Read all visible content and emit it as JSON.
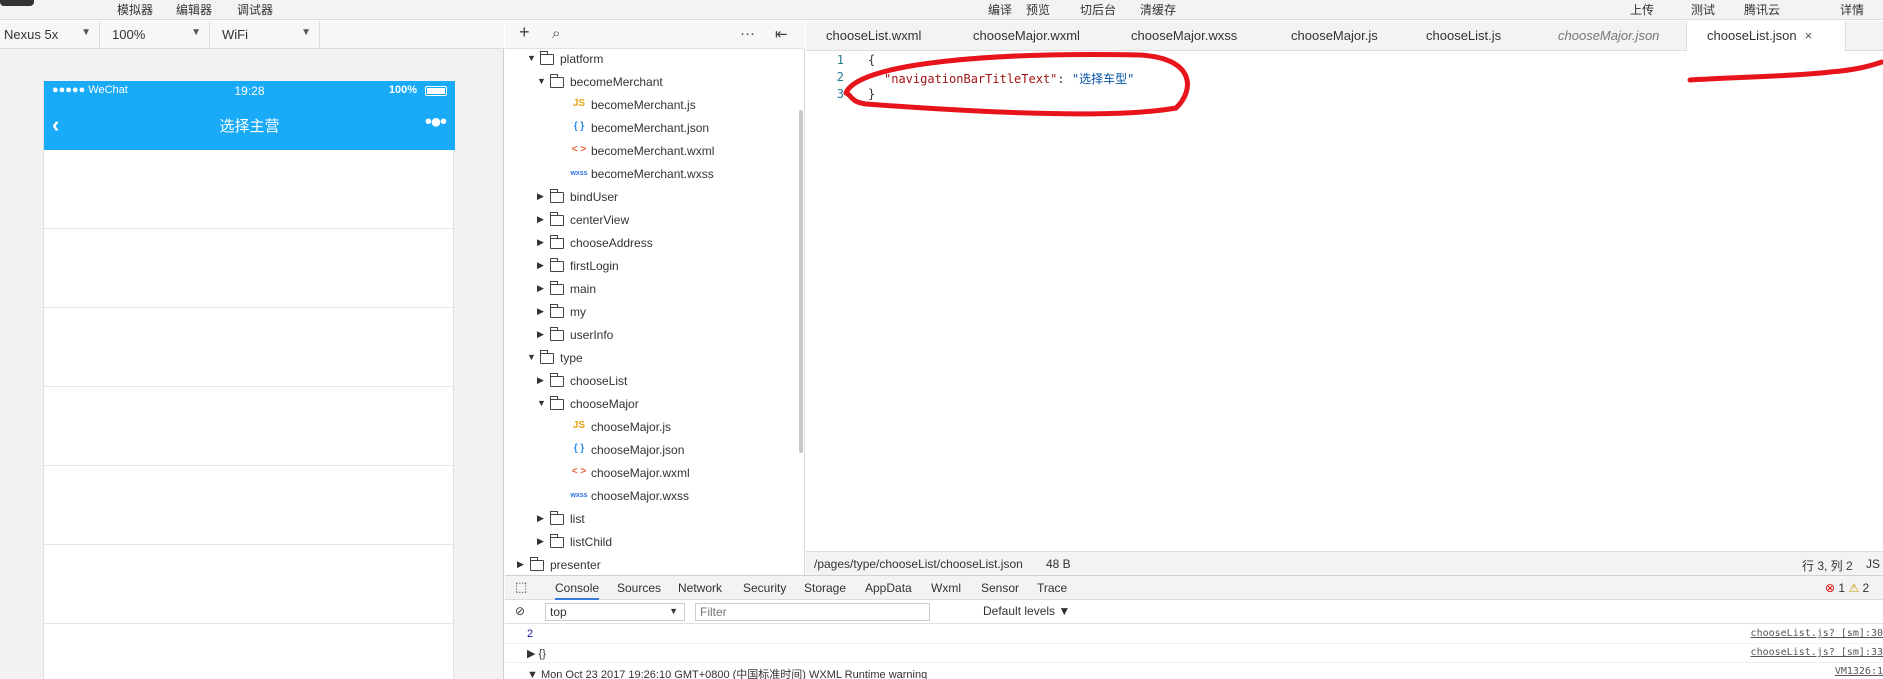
{
  "toolbar": {
    "left_items": [
      "模拟器",
      "编辑器",
      "调试器"
    ],
    "center_items": [
      "编译",
      "预览",
      "切后台",
      "清缓存"
    ],
    "right_items": [
      "上传",
      "测试",
      "腾讯云",
      "详情"
    ]
  },
  "simulator_controls": {
    "device": "Nexus 5x",
    "zoom": "100%",
    "network": "WiFi"
  },
  "phone": {
    "carrier": "●●●●● WeChat",
    "time": "19:28",
    "battery": "100%",
    "nav_title": "选择主营",
    "back_icon": "chevron-left-icon",
    "more_icon": "more-dots-icon",
    "row_count_visible": 7
  },
  "filetree": {
    "items": [
      {
        "type": "folder",
        "name": "platform",
        "expanded": true,
        "depth": 0
      },
      {
        "type": "folder",
        "name": "becomeMerchant",
        "expanded": true,
        "depth": 1
      },
      {
        "type": "file",
        "kind": "js",
        "icon": "JS",
        "name": "becomeMerchant.js",
        "depth": 2
      },
      {
        "type": "file",
        "kind": "json",
        "icon": "{ }",
        "name": "becomeMerchant.json",
        "depth": 2
      },
      {
        "type": "file",
        "kind": "wxml",
        "icon": "< >",
        "name": "becomeMerchant.wxml",
        "depth": 2
      },
      {
        "type": "file",
        "kind": "wxss",
        "icon": "wxss",
        "name": "becomeMerchant.wxss",
        "depth": 2
      },
      {
        "type": "folder",
        "name": "bindUser",
        "expanded": false,
        "depth": 1
      },
      {
        "type": "folder",
        "name": "centerView",
        "expanded": false,
        "depth": 1
      },
      {
        "type": "folder",
        "name": "chooseAddress",
        "expanded": false,
        "depth": 1
      },
      {
        "type": "folder",
        "name": "firstLogin",
        "expanded": false,
        "depth": 1
      },
      {
        "type": "folder",
        "name": "main",
        "expanded": false,
        "depth": 1
      },
      {
        "type": "folder",
        "name": "my",
        "expanded": false,
        "depth": 1
      },
      {
        "type": "folder",
        "name": "userInfo",
        "expanded": false,
        "depth": 1
      },
      {
        "type": "folder",
        "name": "type",
        "expanded": true,
        "depth": 0
      },
      {
        "type": "folder",
        "name": "chooseList",
        "expanded": false,
        "depth": 1
      },
      {
        "type": "folder",
        "name": "chooseMajor",
        "expanded": true,
        "depth": 1
      },
      {
        "type": "file",
        "kind": "js",
        "icon": "JS",
        "name": "chooseMajor.js",
        "depth": 2
      },
      {
        "type": "file",
        "kind": "json",
        "icon": "{ }",
        "name": "chooseMajor.json",
        "depth": 2
      },
      {
        "type": "file",
        "kind": "wxml",
        "icon": "< >",
        "name": "chooseMajor.wxml",
        "depth": 2
      },
      {
        "type": "file",
        "kind": "wxss",
        "icon": "wxss",
        "name": "chooseMajor.wxss",
        "depth": 2
      },
      {
        "type": "folder",
        "name": "list",
        "expanded": false,
        "depth": 1
      },
      {
        "type": "folder",
        "name": "listChild",
        "expanded": false,
        "depth": 1
      },
      {
        "type": "folder",
        "name": "presenter",
        "expanded": false,
        "depth": -1
      }
    ]
  },
  "tabs": [
    {
      "label": "chooseList.wxml",
      "style": "normal"
    },
    {
      "label": "chooseMajor.wxml",
      "style": "normal"
    },
    {
      "label": "chooseMajor.wxss",
      "style": "normal"
    },
    {
      "label": "chooseMajor.js",
      "style": "normal"
    },
    {
      "label": "chooseList.js",
      "style": "normal"
    },
    {
      "label": "chooseMajor.json",
      "style": "italic"
    },
    {
      "label": "chooseList.json",
      "style": "active",
      "close": "×"
    }
  ],
  "editor": {
    "line_numbers": [
      "1",
      "2",
      "3"
    ],
    "line1": "{",
    "line2_key": "\"navigationBarTitleText\"",
    "line2_sep": ": ",
    "line2_value": "\"选择车型\"",
    "line3": "}"
  },
  "statusline": {
    "path": "/pages/type/chooseList/chooseList.json",
    "size": "48 B",
    "cursor": "行 3, 列 2",
    "lang": "JS"
  },
  "console": {
    "tabs": [
      "Console",
      "Sources",
      "Network",
      "Security",
      "Storage",
      "AppData",
      "Wxml",
      "Sensor",
      "Trace"
    ],
    "active_tab": "Console",
    "error_count": "1",
    "warning_count": "2",
    "context": "top",
    "filter_placeholder": "Filter",
    "levels": "Default levels ▼",
    "lines": [
      {
        "text": "2",
        "source": "chooseList.js? [sm]:30"
      },
      {
        "text": "▶ {}",
        "source": "chooseList.js? [sm]:33"
      },
      {
        "text": "▼ Mon Oct 23 2017 19:26:10 GMT+0800 (中国标准时间) WXML Runtime warning",
        "source": "VM1326:1"
      }
    ]
  },
  "colors": {
    "accent_blue": "#19aaf8",
    "annotation_red": "#e8141b"
  }
}
